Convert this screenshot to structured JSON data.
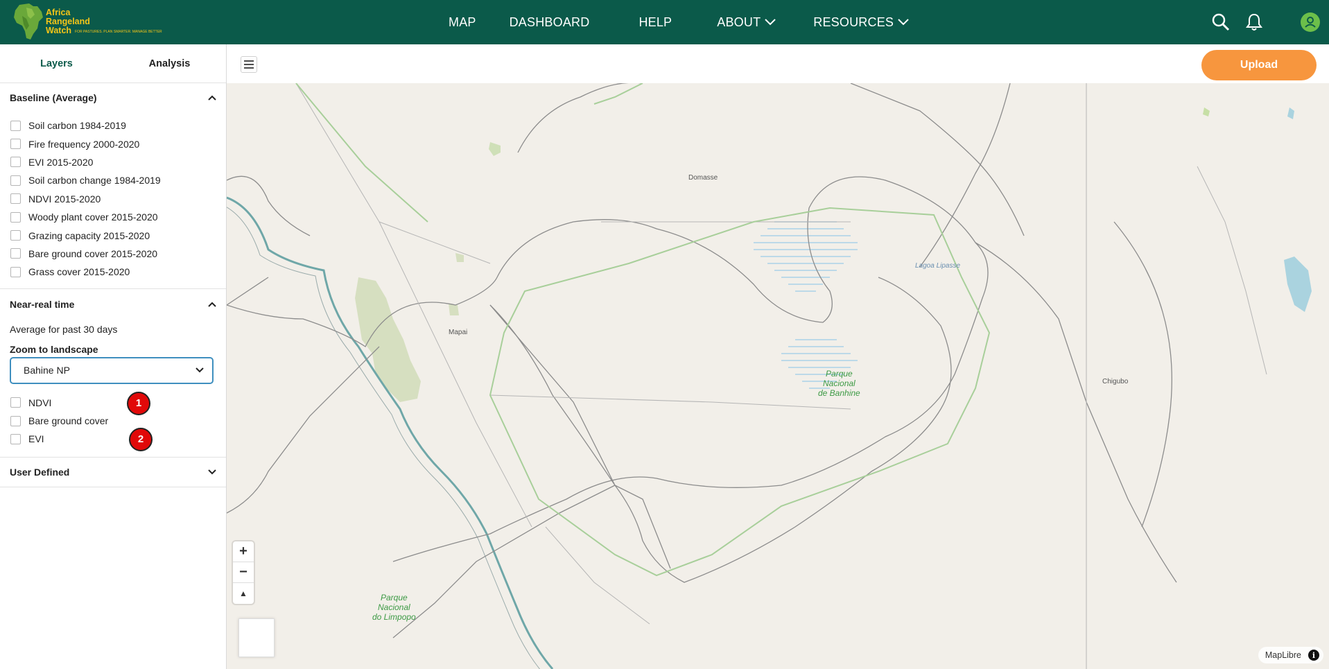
{
  "brand": {
    "name_lines": [
      "Africa",
      "Rangeland",
      "Watch"
    ],
    "tagline": "FOR PASTURES. PLAN SMARTER. MANAGE BETTER",
    "colors": {
      "header": "#0b5a4a",
      "accent": "#f7963e",
      "logo": "#f5c518"
    }
  },
  "nav": {
    "items": [
      {
        "label": "MAP"
      },
      {
        "label": "DASHBOARD"
      },
      {
        "label": "HELP"
      },
      {
        "label": "ABOUT"
      },
      {
        "label": "RESOURCES"
      }
    ],
    "icons": [
      "search-icon",
      "bell-icon",
      "user-avatar-icon"
    ]
  },
  "sidebar": {
    "tabs": [
      {
        "label": "Layers",
        "active": true
      },
      {
        "label": "Analysis",
        "active": false
      }
    ],
    "baseline": {
      "title": "Baseline (Average)",
      "items": [
        "Soil carbon 1984-2019",
        "Fire frequency 2000-2020",
        "EVI 2015-2020",
        "Soil carbon change 1984-2019",
        "NDVI 2015-2020",
        "Woody plant cover 2015-2020",
        "Grazing capacity 2015-2020",
        "Bare ground cover 2015-2020",
        "Grass cover 2015-2020"
      ]
    },
    "near_real_time": {
      "title": "Near-real time",
      "subtitle": "Average for past 30 days",
      "zoom_label": "Zoom to landscape",
      "zoom_value": "Bahine NP",
      "items": [
        "NDVI",
        "Bare ground cover",
        "EVI"
      ],
      "badges": [
        "1",
        "2"
      ]
    },
    "user_defined": {
      "title": "User Defined"
    }
  },
  "toolbar": {
    "upload_label": "Upload"
  },
  "map": {
    "labels": {
      "domasse": "Domasse",
      "mapai": "Mapai",
      "lagoa": "Lagoa Lipasse",
      "chigubo": "Chigubo",
      "park_banhine": [
        "Parque",
        "Nacional",
        "de Banhine"
      ],
      "park_limpopo": [
        "Parque",
        "Nacional",
        "do Limpopo"
      ]
    },
    "attribution": "MapLibre",
    "zoom_in": "+",
    "zoom_out": "−",
    "compass": "▲"
  }
}
